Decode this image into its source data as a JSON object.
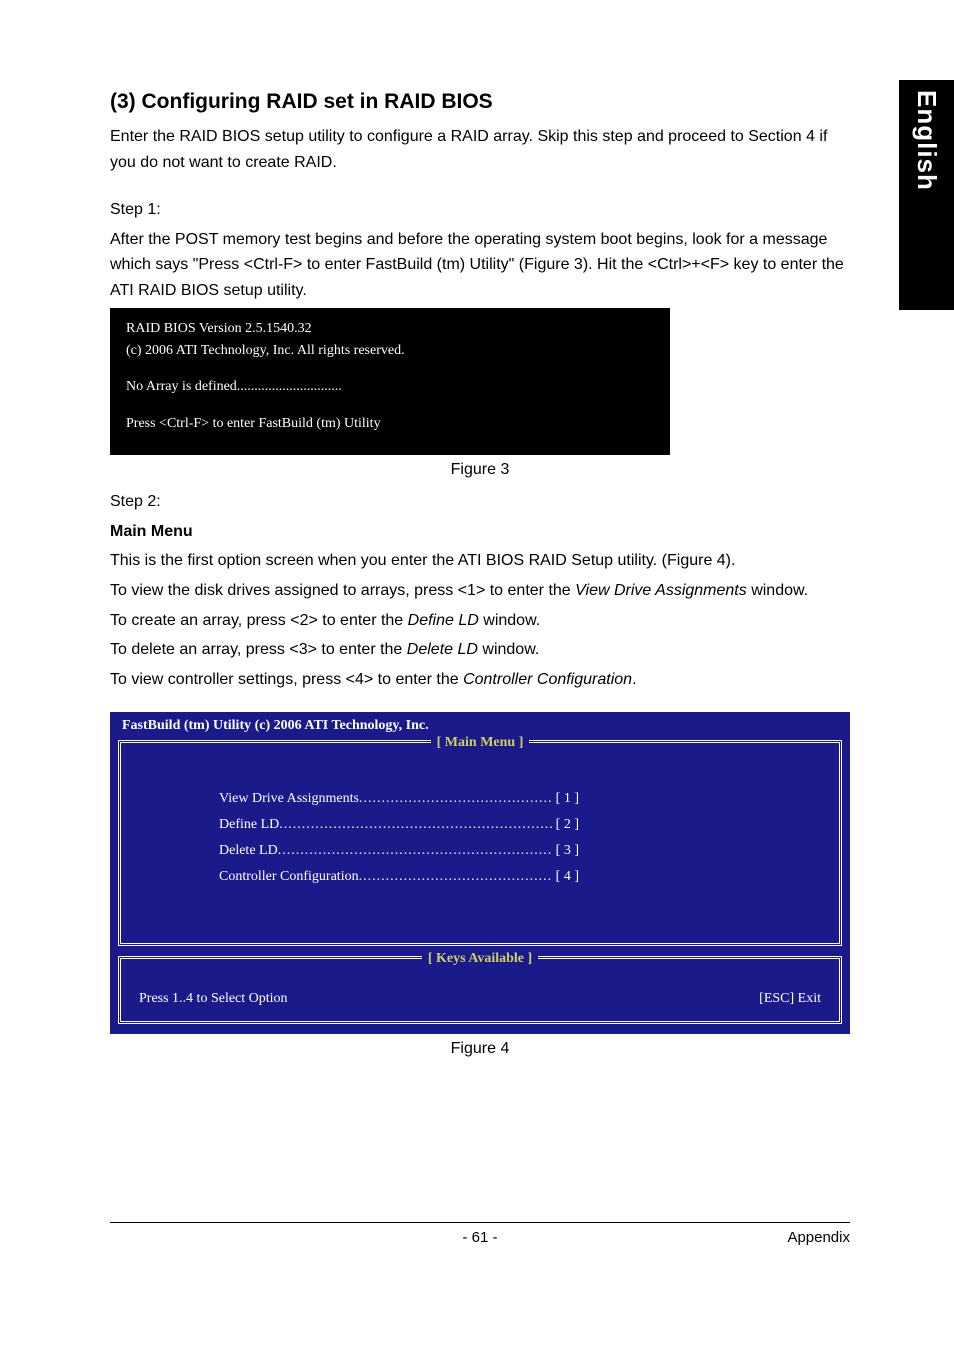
{
  "sideTab": "English",
  "sectionTitle": "(3) Configuring RAID set in RAID BIOS",
  "intro": "Enter the RAID BIOS setup utility to configure a RAID array. Skip this step and proceed to Section 4 if you do not want to create RAID.",
  "step1": {
    "heading": "Step 1:",
    "body": "After the POST memory test begins and before the operating system boot begins, look for a message which says \"Press <Ctrl-F> to enter FastBuild (tm) Utility\" (Figure 3). Hit the <Ctrl>+<F> key to enter the ATI RAID BIOS setup utility."
  },
  "fig3": {
    "line1": "RAID BIOS Version 2.5.1540.32",
    "line2": "(c) 2006 ATI Technology, Inc. All rights reserved.",
    "line3": "No Array is defined..............................",
    "line4": "Press <Ctrl-F> to enter FastBuild (tm) Utility",
    "caption": "Figure 3"
  },
  "step2": {
    "heading": "Step 2:",
    "subheading": "Main Menu",
    "l1": "This is the first option screen when you enter the ATI BIOS RAID Setup utility. (Figure 4).",
    "l2a": "To view the disk drives assigned to arrays, press <1> to enter the ",
    "l2b": "View Drive Assignments",
    "l2c": " window.",
    "l3a": "To create an array, press <2> to enter the ",
    "l3b": "Define LD",
    "l3c": " window.",
    "l4a": "To delete an array, press <3> to enter the ",
    "l4b": "Delete LD",
    "l4c": " window.",
    "l5a": "To view controller settings, press <4> to enter the ",
    "l5b": "Controller Configuration",
    "l5c": "."
  },
  "fig4": {
    "title": "FastBuild (tm) Utility (c) 2006 ATI Technology, Inc.",
    "mainMenuLabel": "[ Main Menu ]",
    "items": [
      {
        "label": "View Drive Assignments",
        "key": "[ 1 ]"
      },
      {
        "label": "Define LD",
        "key": "[ 2 ]"
      },
      {
        "label": "Delete LD",
        "key": "[ 3 ]"
      },
      {
        "label": "Controller Configuration",
        "key": "[ 4 ]"
      }
    ],
    "keysLabel": "[ Keys Available ]",
    "keysLeft": "Press 1..4 to Select Option",
    "keysRight": "[ESC] Exit",
    "caption": "Figure 4"
  },
  "footer": {
    "page": "- 61 -",
    "section": "Appendix"
  }
}
